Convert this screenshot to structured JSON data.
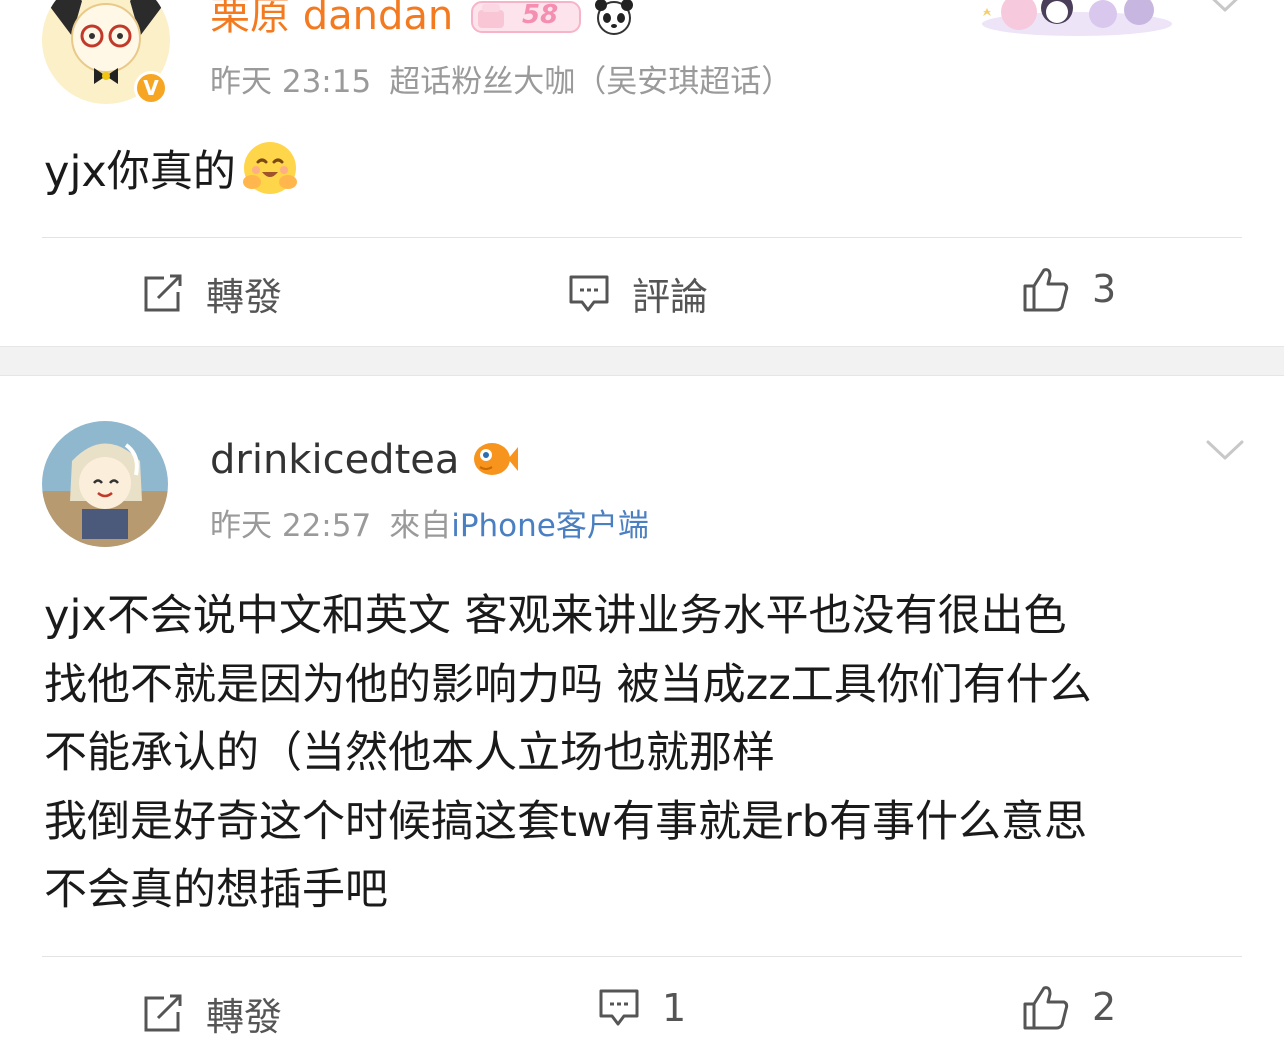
{
  "posts": [
    {
      "user": "栗原 dandan",
      "badge": "58",
      "verified_mark": "V",
      "time": "昨天 23:15",
      "source": "超话粉丝大咖（吴安琪超话）",
      "text": "yjx你真的",
      "actions": {
        "repost": "轉發",
        "comment": "評論",
        "like": "3"
      },
      "name_color": "#f47a20"
    },
    {
      "user": "drinkicedtea",
      "time": "昨天 22:57",
      "source_prefix": "來自",
      "source": "iPhone客户端",
      "lines": [
        "yjx不会说中文和英文 客观来讲业务水平也没有很出色",
        "找他不就是因为他的影响力吗 被当成zz工具你们有什么",
        "不能承认的（当然他本人立场也就那样",
        "我倒是好奇这个时候搞这套tw有事就是rb有事什么意思",
        "不会真的想插手吧"
      ],
      "actions": {
        "repost": "轉發",
        "comment": "1",
        "like": "2"
      }
    }
  ],
  "icons": [
    "emoji-hug-icon",
    "panda-icon",
    "fish-icon",
    "chevron-down-icon",
    "repost-icon",
    "comment-icon",
    "like-icon"
  ]
}
